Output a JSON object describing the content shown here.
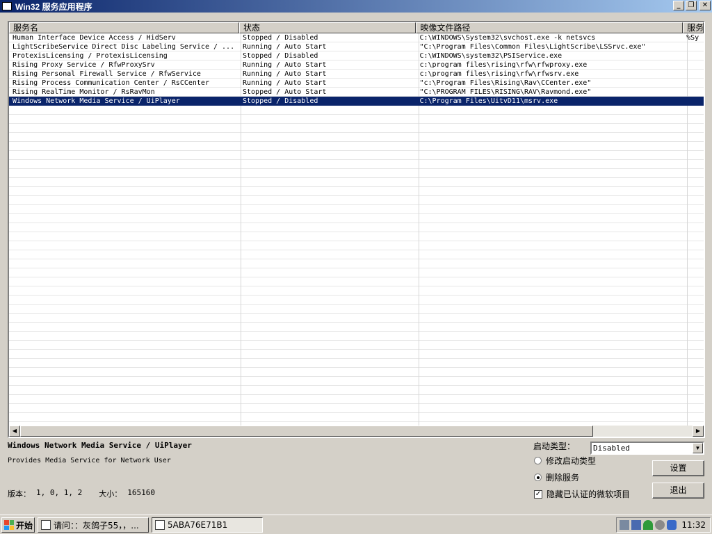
{
  "window": {
    "title": "Win32 服务应用程序"
  },
  "list": {
    "columns": [
      "服务名",
      "状态",
      "映像文件路径",
      "服务"
    ],
    "rows": [
      [
        "Human Interface Device Access / HidServ",
        "Stopped / Disabled",
        "C:\\WINDOWS\\System32\\svchost.exe -k netsvcs",
        "%Sy"
      ],
      [
        "LightScribeService Direct Disc Labeling Service / ...",
        "Running / Auto Start",
        "\"C:\\Program Files\\Common Files\\LightScribe\\LSSrvc.exe\"",
        ""
      ],
      [
        "ProtexisLicensing / ProtexisLicensing",
        "Stopped / Disabled",
        "C:\\WINDOWS\\system32\\PSIService.exe",
        ""
      ],
      [
        "Rising Proxy  Service / RfwProxySrv",
        "Running / Auto Start",
        "c:\\program files\\rising\\rfw\\rfwproxy.exe",
        ""
      ],
      [
        "Rising Personal Firewall Service / RfwService",
        "Running / Auto Start",
        "c:\\program files\\rising\\rfw\\rfwsrv.exe",
        ""
      ],
      [
        "Rising Process Communication Center / RsCCenter",
        "Running / Auto Start",
        "\"c:\\Program Files\\Rising\\Rav\\CCenter.exe\"",
        ""
      ],
      [
        "Rising RealTime Monitor / RsRavMon",
        "Stopped / Auto Start",
        "\"C:\\PROGRAM FILES\\RISING\\RAV\\Ravmond.exe\"",
        ""
      ],
      [
        "Windows Network Media Service / UiPlayer",
        "Stopped / Disabled",
        "C:\\Program Files\\UitvD11\\msrv.exe",
        ""
      ]
    ]
  },
  "detail": {
    "service_title": "Windows Network Media Service / UiPlayer",
    "description": "Provides Media Service for Network User",
    "version_label": "版本：",
    "version_value": "1, 0, 1, 2",
    "size_label": "大小：",
    "size_value": "165160"
  },
  "options": {
    "start_type_label": "启动类型：",
    "start_type_value": "Disabled",
    "radio_modify": "修改启动类型",
    "radio_delete": "删除服务",
    "checkbox_hide": "隐藏已认证的微软项目",
    "settings_button": "设置",
    "exit_button": "退出"
  },
  "taskbar": {
    "start": "开始",
    "task1": "请问：：灰鸽子55，，...",
    "task2": "5ABA76E71B1",
    "clock": "11:32"
  },
  "colors": {
    "titlebar": "#0a246a",
    "selection": "#0a246a",
    "face": "#d4d0c8"
  }
}
